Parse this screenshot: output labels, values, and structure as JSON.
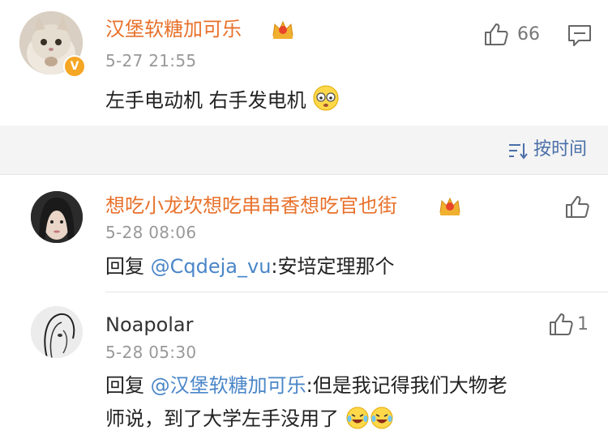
{
  "main_comment": {
    "username": "汉堡软糖加可乐",
    "time": "5-27 21:55",
    "text": "左手电动机  右手发电机",
    "likes": "66",
    "verified_badge": "V"
  },
  "sort": {
    "label": "按时间"
  },
  "replies": [
    {
      "username": "想吃小龙坎想吃串串香想吃官也街",
      "time": "5-28 08:06",
      "prefix": "回复 ",
      "mention": "@Cqdeja_vu",
      "text": ":安培定理那个",
      "likes": ""
    },
    {
      "username": "Noapolar",
      "time": "5-28 05:30",
      "prefix": "回复 ",
      "mention": "@汉堡软糖加可乐",
      "text": ":但是我记得我们大物老",
      "text2": "师说，到了大学左手没用了",
      "likes": "1"
    }
  ],
  "colors": {
    "accent_orange": "#e8712b",
    "mention_blue": "#4a86c8",
    "sort_bg": "#f4f4f4"
  }
}
